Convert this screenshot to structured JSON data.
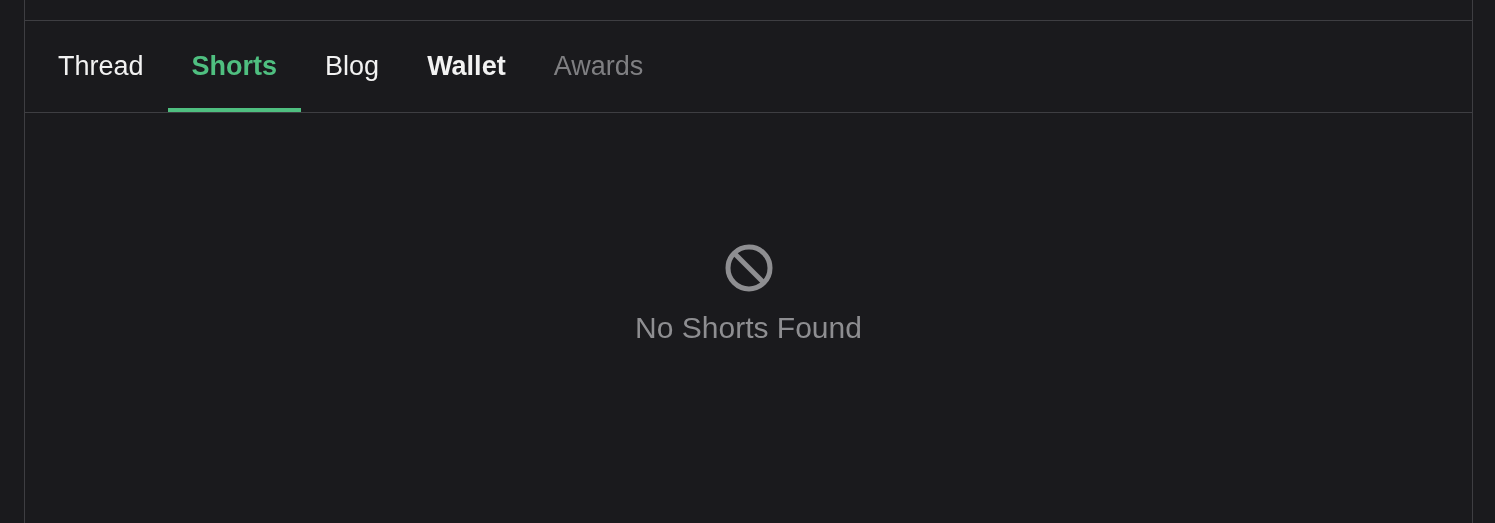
{
  "tabs": [
    {
      "label": "Thread",
      "selected": false,
      "highlighted": false,
      "disabled": false
    },
    {
      "label": "Shorts",
      "selected": true,
      "highlighted": false,
      "disabled": false
    },
    {
      "label": "Blog",
      "selected": false,
      "highlighted": false,
      "disabled": false
    },
    {
      "label": "Wallet",
      "selected": false,
      "highlighted": true,
      "disabled": false
    },
    {
      "label": "Awards",
      "selected": false,
      "highlighted": false,
      "disabled": true
    }
  ],
  "empty_state": {
    "message": "No Shorts Found"
  }
}
